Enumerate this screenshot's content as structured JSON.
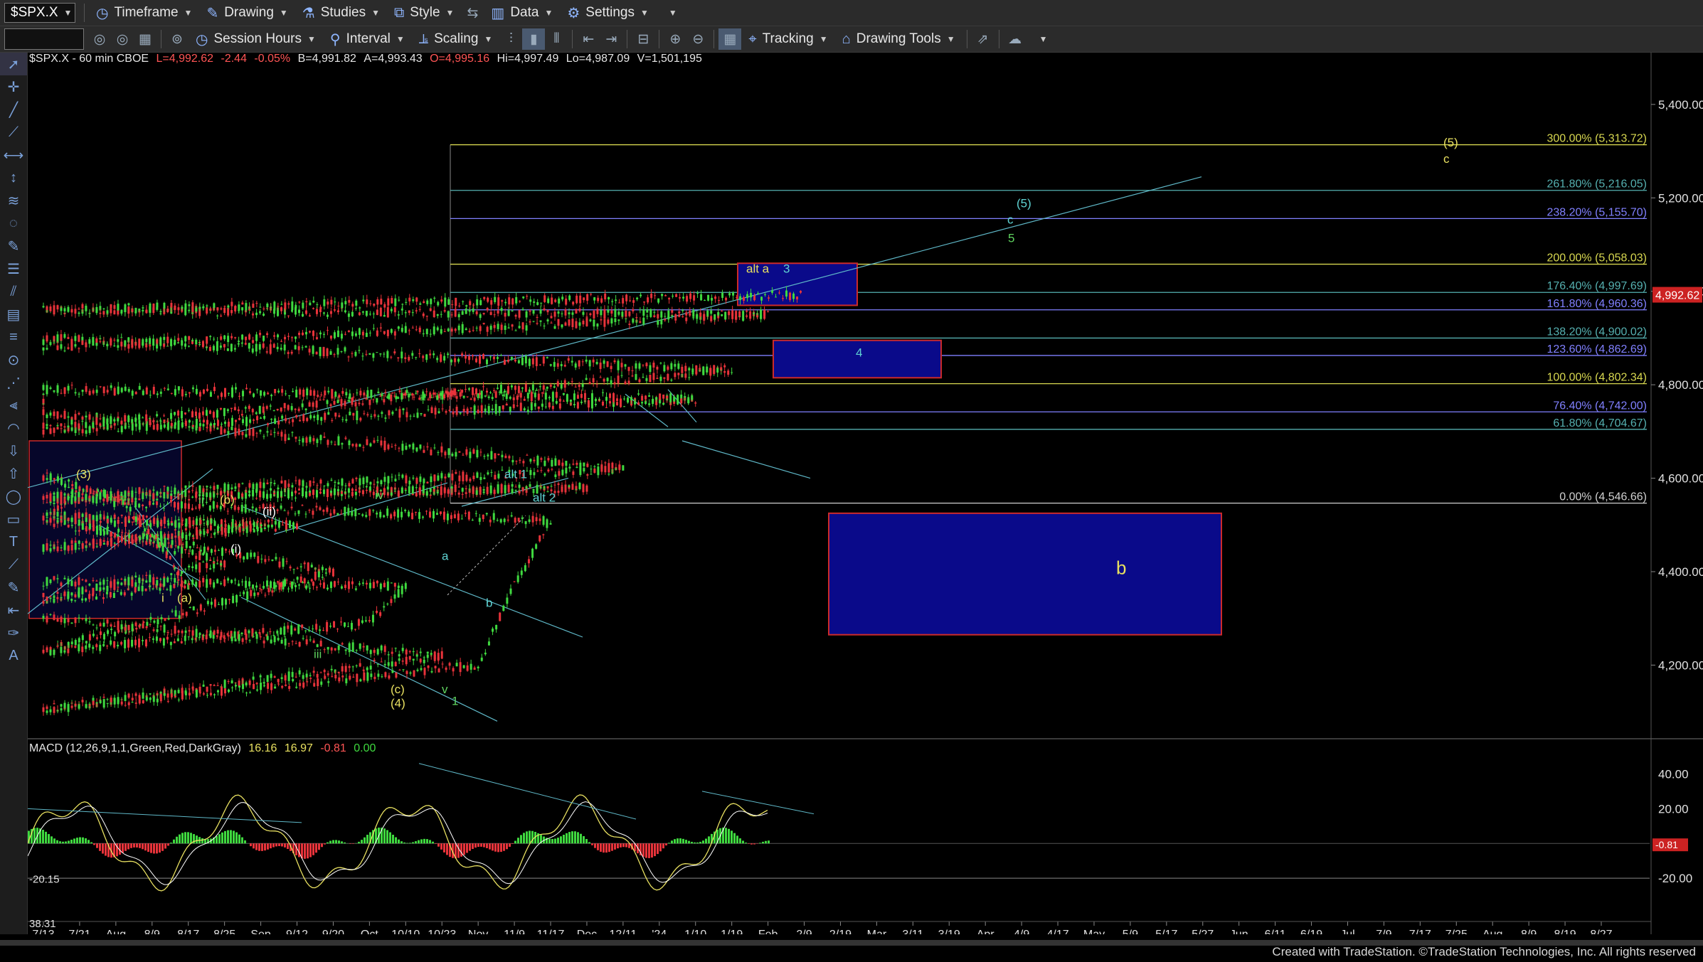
{
  "toolbar1": {
    "symbol": "$SPX.X",
    "timeframe": "Timeframe",
    "drawing": "Drawing",
    "studies": "Studies",
    "style": "Style",
    "data": "Data",
    "settings": "Settings"
  },
  "toolbar2": {
    "session_hours": "Session Hours",
    "interval": "Interval",
    "scaling": "Scaling",
    "tracking": "Tracking",
    "drawing_tools": "Drawing Tools"
  },
  "header": {
    "symbol_line": "$SPX.X - 60 min  CBOE",
    "last": "L=4,992.62",
    "change": "-2.44",
    "change_pct": "-0.05%",
    "bid": "B=4,991.82",
    "ask": "A=4,993.43",
    "open": "O=4,995.16",
    "high": "Hi=4,997.49",
    "low": "Lo=4,987.09",
    "volume": "V=1,501,195"
  },
  "macd_header": {
    "label": "MACD (12,26,9,1,1,Green,Red,DarkGray)",
    "v1": "16.16",
    "v2": "16.97",
    "v3": "-0.81",
    "v4": "0.00"
  },
  "colors": {
    "bg": "#000000",
    "up": "#3fd93f",
    "down": "#e8333a",
    "fib_yellow": "#d8d850",
    "fib_blue": "#8080ff",
    "fib_teal": "#55b0b0",
    "box_fill": "#0a0a8a",
    "box_border": "#cc2a2a",
    "trend": "#5fb8c8",
    "last_price_badge": "#cc2222"
  },
  "chart_data": [
    {
      "type": "line",
      "title": "$SPX.X - 60 min",
      "x": [
        "7/13",
        "7/21",
        "Aug",
        "8/9",
        "8/17",
        "8/25",
        "Sep",
        "9/12",
        "9/20",
        "Oct",
        "10/10",
        "10/23",
        "Nov",
        "11/9",
        "11/17",
        "Dec",
        "12/11",
        "'24",
        "1/10",
        "1/19",
        "Feb",
        "2/9",
        "2/19",
        "Mar",
        "3/11",
        "3/19",
        "Apr",
        "4/9",
        "4/17",
        "May",
        "5/9",
        "5/17",
        "5/27",
        "Jun",
        "6/11",
        "6/19",
        "Jul",
        "7/9",
        "7/17",
        "7/25",
        "Aug",
        "8/9",
        "8/19",
        "8/27"
      ],
      "price_ticks": [
        "5,400.00",
        "5,200.00",
        "5,000.00",
        "4,800.00",
        "4,600.00",
        "4,400.00",
        "4,200.00"
      ],
      "last_price_label": "4,992.62",
      "ylim": [
        4050,
        5450
      ],
      "series": [
        {
          "values": [
            {
              "x": "7/13",
              "y": 4510
            },
            {
              "x": "7/21",
              "y": 4580
            },
            {
              "x": "7/27",
              "y": 4605
            },
            {
              "x": "Aug",
              "y": 4560
            },
            {
              "x": "8/9",
              "y": 4480
            },
            {
              "x": "8/17",
              "y": 4370
            },
            {
              "x": "8/20",
              "y": 4340
            },
            {
              "x": "8/25",
              "y": 4420
            },
            {
              "x": "8/31",
              "y": 4520
            },
            {
              "x": "Sep",
              "y": 4500
            },
            {
              "x": "9/7",
              "y": 4450
            },
            {
              "x": "9/12",
              "y": 4500
            },
            {
              "x": "9/15",
              "y": 4510
            },
            {
              "x": "9/20",
              "y": 4400
            },
            {
              "x": "9/27",
              "y": 4230
            },
            {
              "x": "Oct",
              "y": 4290
            },
            {
              "x": "10/10",
              "y": 4370
            },
            {
              "x": "10/12",
              "y": 4380
            },
            {
              "x": "10/18",
              "y": 4300
            },
            {
              "x": "10/23",
              "y": 4220
            },
            {
              "x": "10/27",
              "y": 4105
            },
            {
              "x": "Nov",
              "y": 4200
            },
            {
              "x": "11/9",
              "y": 4370
            },
            {
              "x": "11/17",
              "y": 4510
            },
            {
              "x": "11/24",
              "y": 4555
            },
            {
              "x": "Dec",
              "y": 4580
            },
            {
              "x": "12/5",
              "y": 4560
            },
            {
              "x": "12/11",
              "y": 4620
            },
            {
              "x": "12/18",
              "y": 4740
            },
            {
              "x": "12/22",
              "y": 4760
            },
            {
              "x": "12/28",
              "y": 4790
            },
            {
              "x": "1/5",
              "y": 4700
            },
            {
              "x": "1/10",
              "y": 4770
            },
            {
              "x": "1/12",
              "y": 4790
            },
            {
              "x": "1/17",
              "y": 4710
            },
            {
              "x": "1/19",
              "y": 4830
            },
            {
              "x": "1/25",
              "y": 4900
            },
            {
              "x": "1/31",
              "y": 4880
            },
            {
              "x": "Feb",
              "y": 4950
            },
            {
              "x": "2/5",
              "y": 4960
            },
            {
              "x": "2/9",
              "y": 4992.62
            }
          ]
        }
      ]
    },
    {
      "type": "area",
      "title": "MACD (12,26,9,1,1,Green,Red,DarkGray)",
      "y_ticks": [
        "40.00",
        "20.00",
        "-20.00"
      ],
      "labels": [
        "-20.15",
        "38.31",
        "-0.81"
      ],
      "ylim": [
        -40,
        50
      ]
    }
  ],
  "fib_levels": [
    {
      "label": "300.00% (5,313.72)",
      "value": 5313.72,
      "color": "#d8d850"
    },
    {
      "label": "261.80% (5,216.05)",
      "value": 5216.05,
      "color": "#55b0b0"
    },
    {
      "label": "238.20% (5,155.70)",
      "value": 5155.7,
      "color": "#8080ff"
    },
    {
      "label": "200.00% (5,058.03)",
      "value": 5058.03,
      "color": "#d8d850"
    },
    {
      "label": "176.40% (4,997.69)",
      "value": 4997.69,
      "color": "#55b0b0"
    },
    {
      "label": "161.80% (4,960.36)",
      "value": 4960.36,
      "color": "#8080ff"
    },
    {
      "label": "138.20% (4,900.02)",
      "value": 4900.02,
      "color": "#55b0b0"
    },
    {
      "label": "123.60% (4,862.69)",
      "value": 4862.69,
      "color": "#8080ff"
    },
    {
      "label": "100.00% (4,802.34)",
      "value": 4802.34,
      "color": "#d8d850"
    },
    {
      "label": "76.40% (4,742.00)",
      "value": 4742.0,
      "color": "#8080ff"
    },
    {
      "label": "61.80% (4,704.67)",
      "value": 4704.67,
      "color": "#55b0b0"
    },
    {
      "label": "0.00% (4,546.66)",
      "value": 4546.66,
      "color": "#d0d0d0"
    }
  ],
  "wave_labels": [
    {
      "text": "(3)",
      "color": "#e8e060"
    },
    {
      "text": "ii",
      "color": "#5fd35f"
    },
    {
      "text": "(b)",
      "color": "#e8e060"
    },
    {
      "text": "(ii)",
      "color": "#ffffff"
    },
    {
      "text": "(i)",
      "color": "#ffffff"
    },
    {
      "text": "i",
      "color": "#e8e060"
    },
    {
      "text": "(a)",
      "color": "#e8e060"
    },
    {
      "text": "iv",
      "color": "#5fd35f"
    },
    {
      "text": "iii",
      "color": "#5fd35f"
    },
    {
      "text": "a",
      "color": "#5fd3d3"
    },
    {
      "text": "b",
      "color": "#5fd3d3"
    },
    {
      "text": "(c)",
      "color": "#e8e060"
    },
    {
      "text": "(4)",
      "color": "#e8e060"
    },
    {
      "text": "v",
      "color": "#5fd35f"
    },
    {
      "text": "1",
      "color": "#5fd35f"
    },
    {
      "text": "alt 1",
      "color": "#5fd3d3"
    },
    {
      "text": "alt 2",
      "color": "#5fd3d3"
    },
    {
      "text": "alt a",
      "color": "#e8e060"
    },
    {
      "text": "3",
      "color": "#5fd3d3"
    },
    {
      "text": "4",
      "color": "#5fd3d3"
    },
    {
      "text": "(5)",
      "color": "#5fd3d3"
    },
    {
      "text": "c",
      "color": "#5fd3d3"
    },
    {
      "text": "5",
      "color": "#5fd35f"
    },
    {
      "text": "(5)",
      "color": "#e8e060"
    },
    {
      "text": "c",
      "color": "#e8e060"
    },
    {
      "text": "b",
      "color": "#e8e060"
    }
  ],
  "footer": {
    "credit": "Created with TradeStation. ©TradeStation Technologies, Inc. All rights reserved"
  }
}
